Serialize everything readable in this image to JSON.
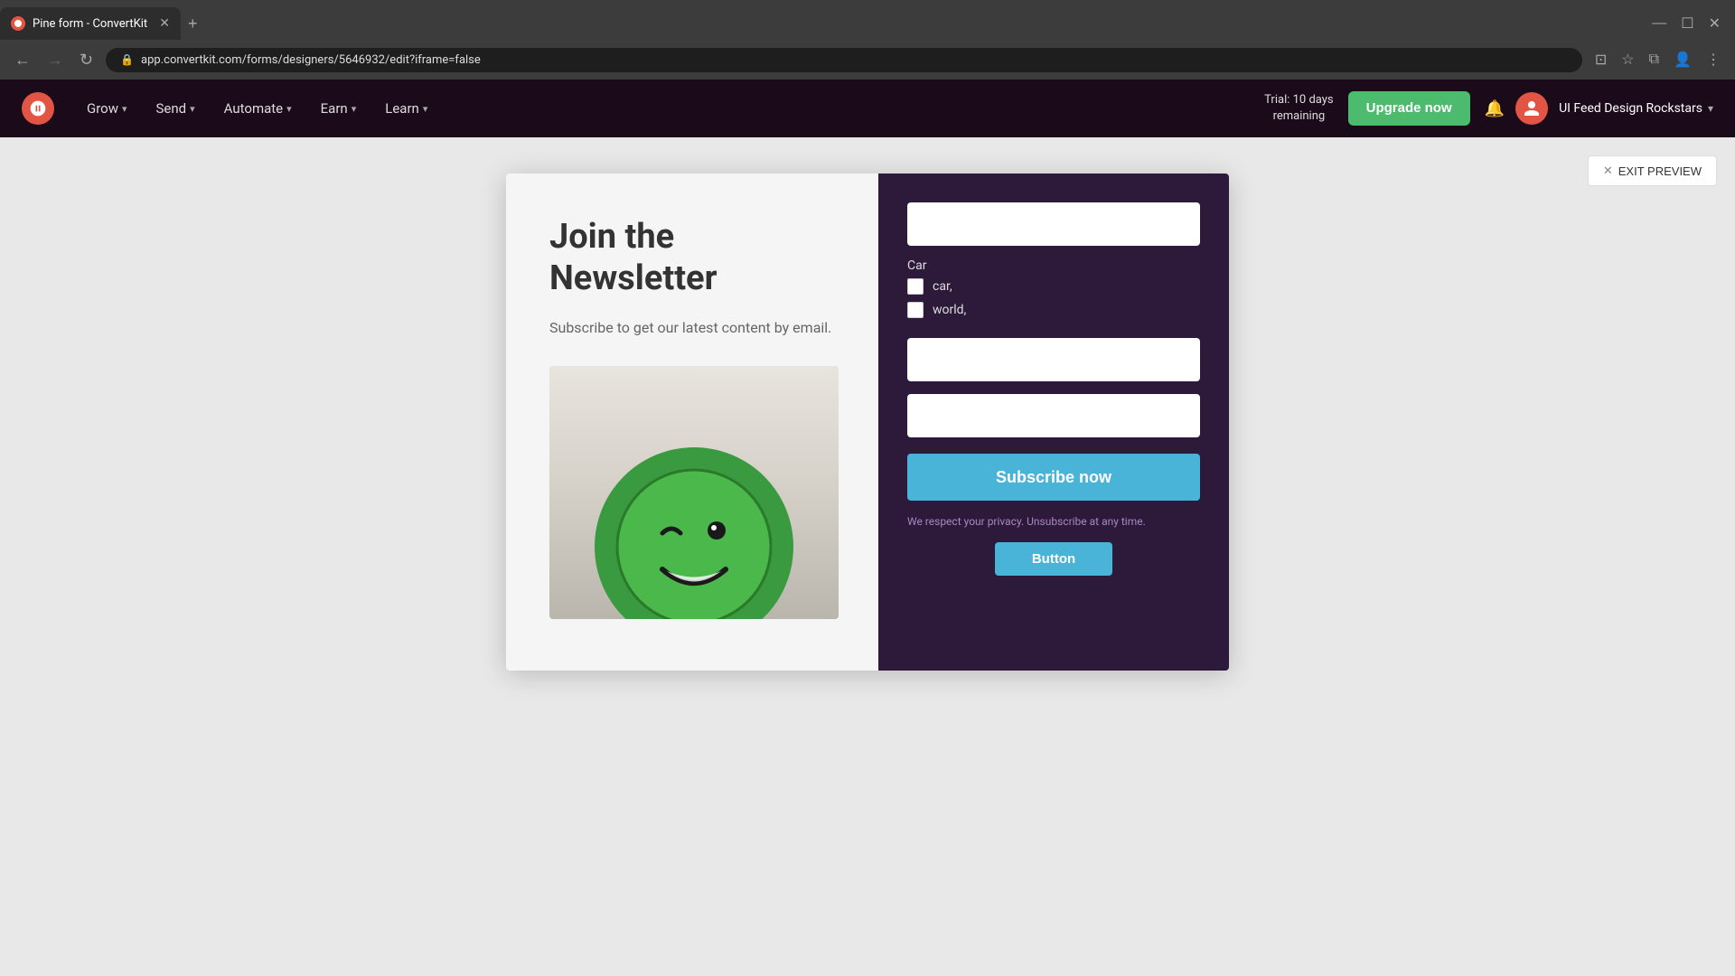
{
  "browser": {
    "tab_title": "Pine form - ConvertKit",
    "url": "app.convertkit.com/forms/designers/5646932/edit?iframe=false",
    "favicon_color": "#e25444"
  },
  "nav": {
    "logo_alt": "ConvertKit logo",
    "items": [
      {
        "label": "Grow",
        "has_chevron": true
      },
      {
        "label": "Send",
        "has_chevron": true
      },
      {
        "label": "Automate",
        "has_chevron": true
      },
      {
        "label": "Earn",
        "has_chevron": true
      },
      {
        "label": "Learn",
        "has_chevron": true
      }
    ],
    "trial_text_line1": "Trial: 10 days",
    "trial_text_line2": "remaining",
    "upgrade_label": "Upgrade now",
    "workspace_name": "UI Feed Design Rockstars"
  },
  "preview": {
    "exit_label": "EXIT PREVIEW",
    "form": {
      "title": "Join the Newsletter",
      "subtitle": "Subscribe to get our latest content by email.",
      "input1_placeholder": "",
      "checkbox_group_label": "Car",
      "checkboxes": [
        {
          "label": "car,",
          "checked": false
        },
        {
          "label": "world,",
          "checked": false
        }
      ],
      "input2_placeholder": "",
      "input3_placeholder": "",
      "subscribe_label": "Subscribe now",
      "privacy_text": "We respect your privacy. Unsubscribe at any time.",
      "button_label": "Button"
    }
  }
}
